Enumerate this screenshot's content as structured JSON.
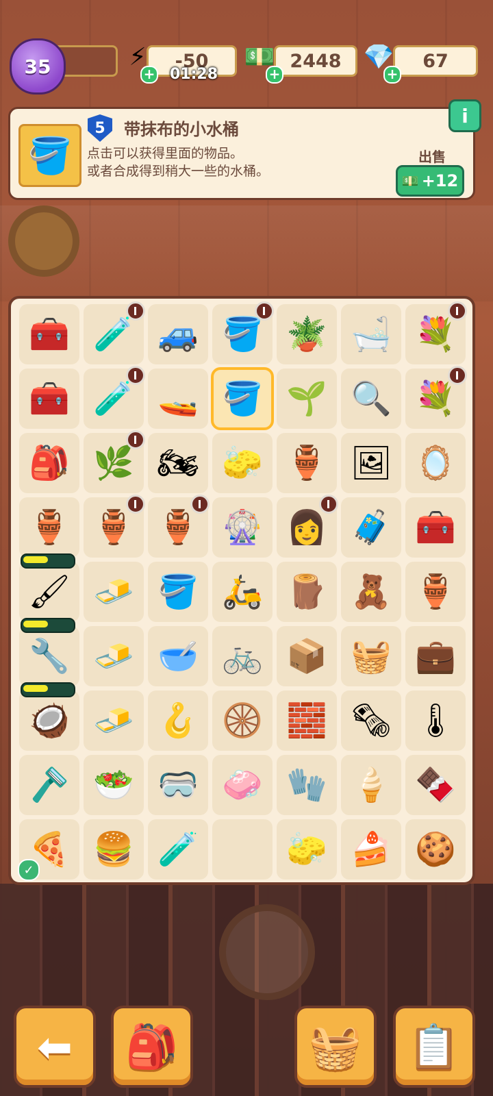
{
  "topbar": {
    "level": "35",
    "energy": {
      "value": "-50",
      "timer": "01:28",
      "icon": "lightning-icon"
    },
    "cash": {
      "value": "2448",
      "icon": "cash-icon"
    },
    "gems": {
      "value": "67",
      "icon": "ruby-icon"
    }
  },
  "info": {
    "item_level": "5",
    "title": "带抹布的小水桶",
    "desc_line1": "点击可以获得里面的物品。",
    "desc_line2": "或者合成得到稍大一些的水桶。",
    "info_button": "i",
    "sell_label": "出售",
    "sell_value": "+12"
  },
  "board": {
    "cells": [
      {
        "icon": "🧰",
        "name": "toolbox-cart",
        "gen": false
      },
      {
        "icon": "🧪",
        "name": "medical-kit-generator",
        "gen": true
      },
      {
        "icon": "🚙",
        "name": "jeep",
        "gen": false
      },
      {
        "icon": "🪣",
        "name": "bucket-generator",
        "gen": true
      },
      {
        "icon": "🪴",
        "name": "potted-plant",
        "gen": false
      },
      {
        "icon": "🛁",
        "name": "bathtub",
        "gen": false
      },
      {
        "icon": "💐",
        "name": "flower-basket-generator",
        "gen": true
      },
      {
        "icon": "🧰",
        "name": "red-toolbox",
        "gen": false
      },
      {
        "icon": "🧪",
        "name": "medical-kit-generator",
        "gen": true
      },
      {
        "icon": "🚤",
        "name": "jet-ski",
        "gen": false
      },
      {
        "icon": "🪣",
        "name": "small-bucket-with-cloth",
        "gen": false,
        "selected": true
      },
      {
        "icon": "🌱",
        "name": "seedling-pot",
        "gen": false
      },
      {
        "icon": "🔍",
        "name": "magnifier-set",
        "gen": false
      },
      {
        "icon": "💐",
        "name": "flower-basket-generator",
        "gen": true
      },
      {
        "icon": "🎒",
        "name": "white-bag",
        "gen": false
      },
      {
        "icon": "🌿",
        "name": "plant-bowl-generator",
        "gen": true
      },
      {
        "icon": "🏍",
        "name": "motorbike",
        "gen": false
      },
      {
        "icon": "🧽",
        "name": "cleaning-bucket",
        "gen": false
      },
      {
        "icon": "🏺",
        "name": "soil-pot",
        "gen": false
      },
      {
        "icon": "🖼",
        "name": "photo-frame",
        "gen": false
      },
      {
        "icon": "🪞",
        "name": "vanity-mirror",
        "gen": false
      },
      {
        "icon": "🏺",
        "name": "vase",
        "gen": false
      },
      {
        "icon": "🏺",
        "name": "vase-generator",
        "gen": true
      },
      {
        "icon": "🏺",
        "name": "amphora-generator",
        "gen": true
      },
      {
        "icon": "🎡",
        "name": "fan-machine",
        "gen": false
      },
      {
        "icon": "👩",
        "name": "character-generator",
        "gen": true
      },
      {
        "icon": "🧳",
        "name": "cart-with-jars",
        "gen": false
      },
      {
        "icon": "🧰",
        "name": "red-toolbox-small",
        "gen": false
      },
      {
        "icon": "🖌",
        "name": "paintbrush",
        "gen": false,
        "progress": 0.5
      },
      {
        "icon": "🧈",
        "name": "butter-cubes",
        "gen": false
      },
      {
        "icon": "🪣",
        "name": "yellow-bucket",
        "gen": false
      },
      {
        "icon": "🛵",
        "name": "scooter",
        "gen": false
      },
      {
        "icon": "🪵",
        "name": "wood-blocks",
        "gen": false
      },
      {
        "icon": "🧸",
        "name": "plush-toy",
        "gen": false
      },
      {
        "icon": "🏺",
        "name": "broken-pot",
        "gen": false
      },
      {
        "icon": "🔧",
        "name": "tongs",
        "gen": false,
        "progress": 0.5
      },
      {
        "icon": "🧈",
        "name": "butter-pair",
        "gen": false
      },
      {
        "icon": "🥣",
        "name": "small-bowl",
        "gen": false
      },
      {
        "icon": "🚲",
        "name": "bicycle",
        "gen": false
      },
      {
        "icon": "📦",
        "name": "paper-blocks",
        "gen": false
      },
      {
        "icon": "🧺",
        "name": "cloth-sack",
        "gen": false
      },
      {
        "icon": "💼",
        "name": "first-aid-case",
        "gen": false
      },
      {
        "icon": "🥥",
        "name": "coconut",
        "gen": false,
        "progress": 0.5
      },
      {
        "icon": "🧈",
        "name": "butter-cube",
        "gen": false
      },
      {
        "icon": "🪝",
        "name": "hook",
        "gen": false
      },
      {
        "icon": "🛞",
        "name": "wheels",
        "gen": false
      },
      {
        "icon": "🧱",
        "name": "tile",
        "gen": false
      },
      {
        "icon": "🗞",
        "name": "cloth-stack",
        "gen": false
      },
      {
        "icon": "🌡",
        "name": "thermometer-gun",
        "gen": false
      },
      {
        "icon": "🪒",
        "name": "squeegee",
        "gen": false
      },
      {
        "icon": "🥗",
        "name": "salad-bowl",
        "gen": false
      },
      {
        "icon": "🥽",
        "name": "goggles",
        "gen": false
      },
      {
        "icon": "🧼",
        "name": "soap-bar",
        "gen": false
      },
      {
        "icon": "🧤",
        "name": "green-glove",
        "gen": false
      },
      {
        "icon": "🍦",
        "name": "ice-cream",
        "gen": false
      },
      {
        "icon": "🍫",
        "name": "popsicle",
        "gen": false
      },
      {
        "icon": "🍕",
        "name": "pizza-bag",
        "gen": false,
        "check": true
      },
      {
        "icon": "🍔",
        "name": "burger-meal",
        "gen": false
      },
      {
        "icon": "🧪",
        "name": "medicine-bottles",
        "gen": false
      },
      {
        "icon": "",
        "name": "empty-slot",
        "gen": false
      },
      {
        "icon": "🧽",
        "name": "green-sponge",
        "gen": false
      },
      {
        "icon": "🍰",
        "name": "strawberry-cake",
        "gen": false
      },
      {
        "icon": "🍪",
        "name": "cookie-bag",
        "gen": false
      }
    ]
  },
  "bottom": [
    {
      "name": "back-button",
      "icon": "⬅"
    },
    {
      "name": "backpack-button",
      "icon": "🎒"
    },
    {
      "name": "shop-basket-button",
      "icon": "🧺"
    },
    {
      "name": "tasks-clipboard-button",
      "icon": "📋"
    }
  ]
}
